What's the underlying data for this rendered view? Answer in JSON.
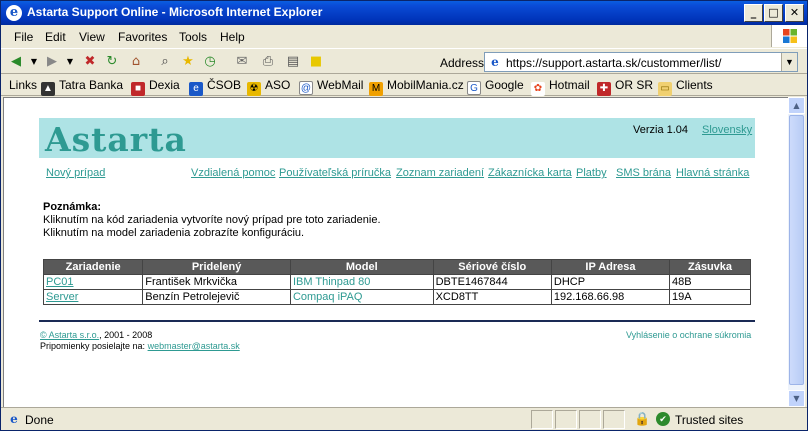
{
  "window": {
    "title": "Astarta Support Online - Microsoft Internet Explorer",
    "controls": [
      "_",
      "□",
      "✕"
    ]
  },
  "menu": [
    "File",
    "Edit",
    "View",
    "Favorites",
    "Tools",
    "Help"
  ],
  "address": {
    "label": "Address",
    "url": "https://support.astarta.sk/custommer/list/"
  },
  "links": {
    "label": "Links",
    "items": [
      "Tatra Banka",
      "Dexia",
      "ČSOB",
      "ASO",
      "WebMail",
      "MobilMania.cz",
      "Google",
      "Hotmail",
      "OR SR",
      "Clients"
    ]
  },
  "page": {
    "logo": "Astarta",
    "version": "Verzia 1.04",
    "language": "Slovensky",
    "nav": {
      "new_case": "Nový prípad",
      "remote_help": "Vzdialená pomoc",
      "user_guide": "Používateľská príručka",
      "device_list": "Zoznam zariadení",
      "customer_card": "Zákaznícka karta",
      "payments": "Platby",
      "sms_gateway": "SMS brána",
      "home": "Hlavná stránka"
    },
    "note": {
      "heading": "Poznámka:",
      "line1": "Kliknutím na kód zariadenia vytvoríte nový prípad pre toto zariadenie.",
      "line2": "Kliknutím na model zariadenia zobrazíte konfiguráciu."
    },
    "table": {
      "headers": [
        "Zariadenie",
        "Pridelený",
        "Model",
        "Sériové číslo",
        "IP Adresa",
        "Zásuvka"
      ],
      "rows": [
        {
          "device": "PC01",
          "assigned": "František Mrkvička",
          "model": "IBM Thinpad 80",
          "serial": "DBTE1467844",
          "ip": "DHCP",
          "socket": "48B"
        },
        {
          "device": "Server",
          "assigned": "Benzín Petrolejevič",
          "model": "Compaq iPAQ",
          "serial": "XCD8TT",
          "ip": "192.168.66.98",
          "socket": "19A"
        }
      ]
    },
    "footer": {
      "copyright_link": "© Astarta s.r.o.",
      "copyright_rest": ", 2001 - 2008",
      "comments_text": "Pripomienky posielajte na:",
      "email": "webmaster@astarta.sk",
      "privacy": "Vyhlásenie o ochrane súkromia"
    }
  },
  "status": {
    "text": "Done",
    "zone": "Trusted sites"
  },
  "colors": {
    "accent": "#2e9a92",
    "header_band": "#aee3e5",
    "table_header": "#595959"
  }
}
